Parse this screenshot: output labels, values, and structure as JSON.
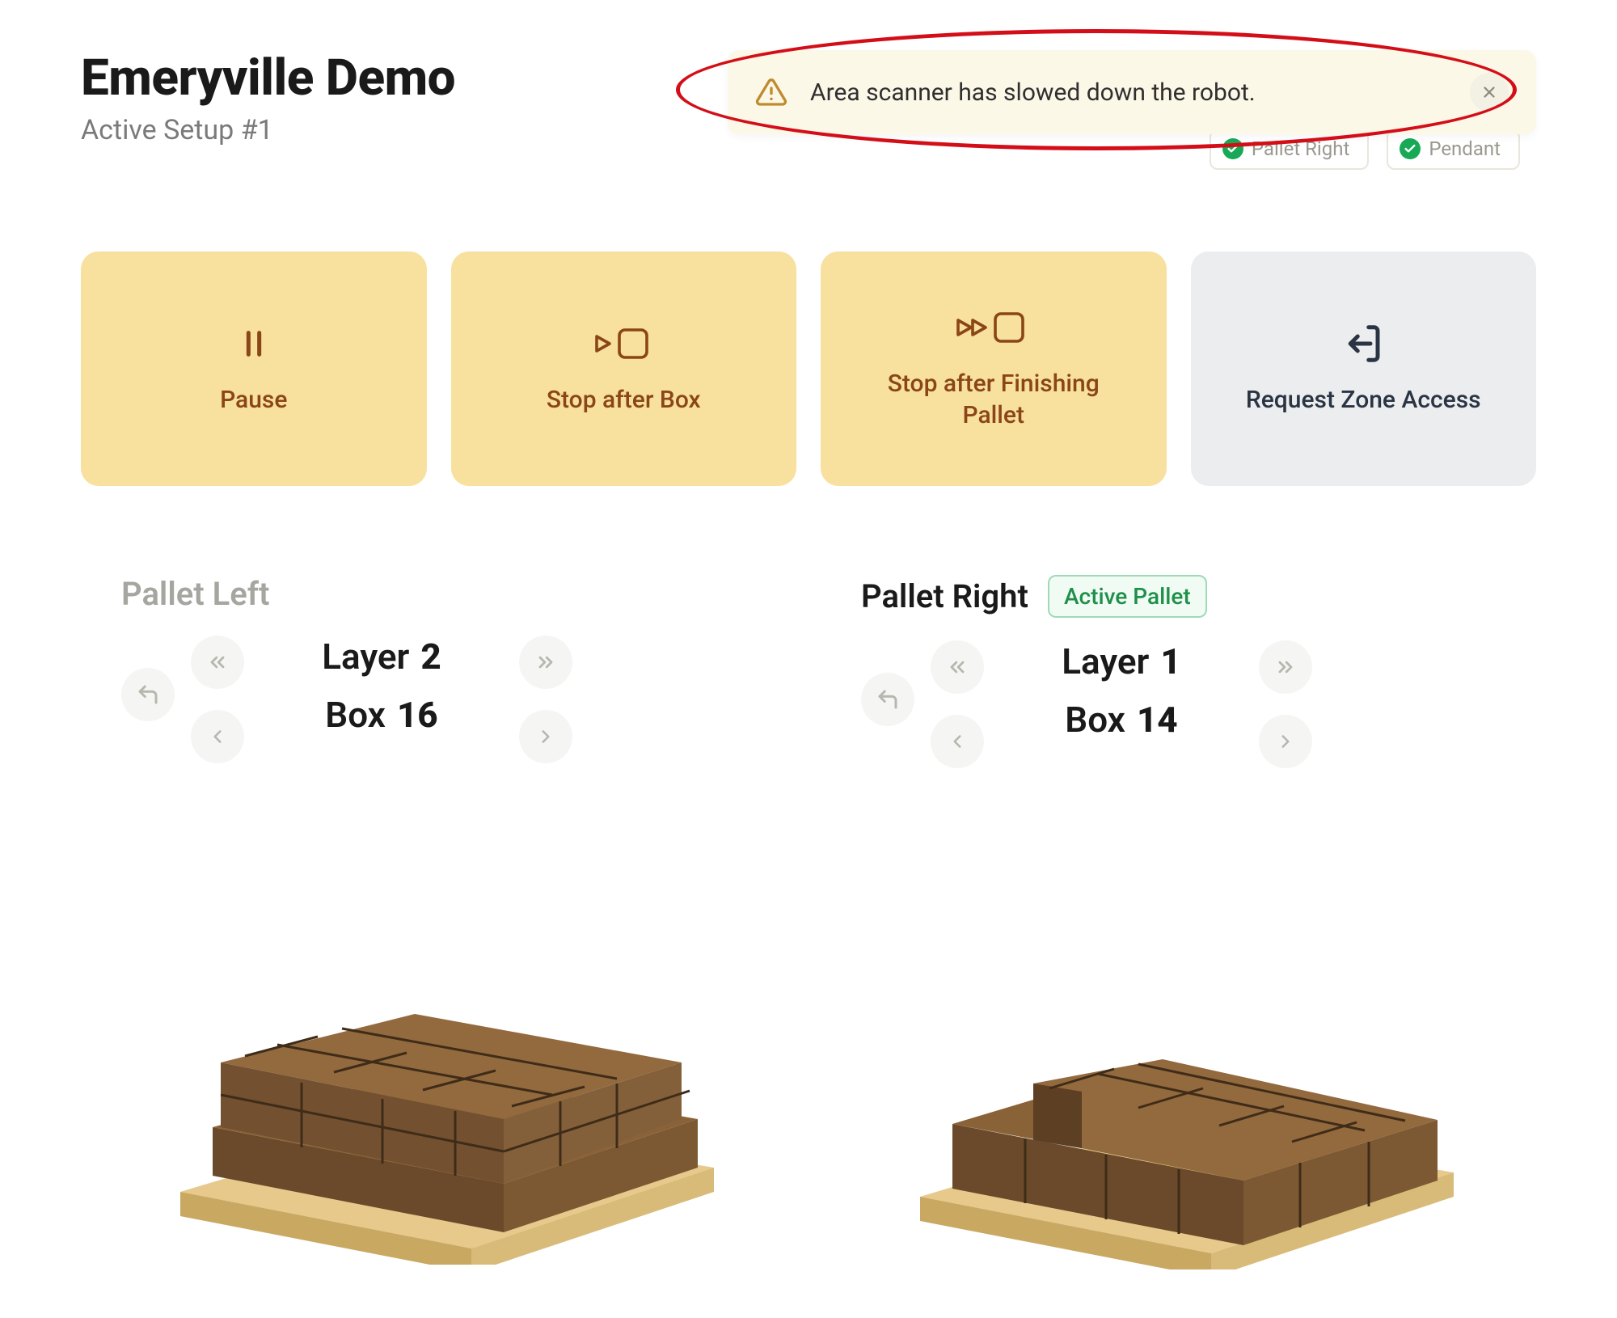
{
  "header": {
    "title": "Emeryville Demo",
    "subtitle": "Active Setup #1"
  },
  "notification": {
    "message": "Area scanner has slowed down the robot.",
    "icon": "warning-triangle"
  },
  "status": {
    "items": [
      {
        "label": "Pallet Right",
        "ok": true
      },
      {
        "label": "Pendant",
        "ok": true
      }
    ]
  },
  "actions": {
    "pause": "Pause",
    "stop_box": "Stop after Box",
    "stop_pallet": "Stop after Finishing Pallet",
    "request_zone": "Request Zone Access"
  },
  "pallets": {
    "left": {
      "name": "Pallet Left",
      "layer_label": "Layer",
      "layer_value": "2",
      "box_label": "Box",
      "box_value": "16",
      "active": false
    },
    "right": {
      "name": "Pallet Right",
      "layer_label": "Layer",
      "layer_value": "1",
      "box_label": "Box",
      "box_value": "14",
      "active": true,
      "active_badge": "Active Pallet"
    }
  },
  "colors": {
    "accent_yellow": "#f8e09f",
    "accent_brown": "#8a4616",
    "gray_card": "#ebedef",
    "status_green": "#18a957",
    "annotation_red": "#d40e18"
  }
}
